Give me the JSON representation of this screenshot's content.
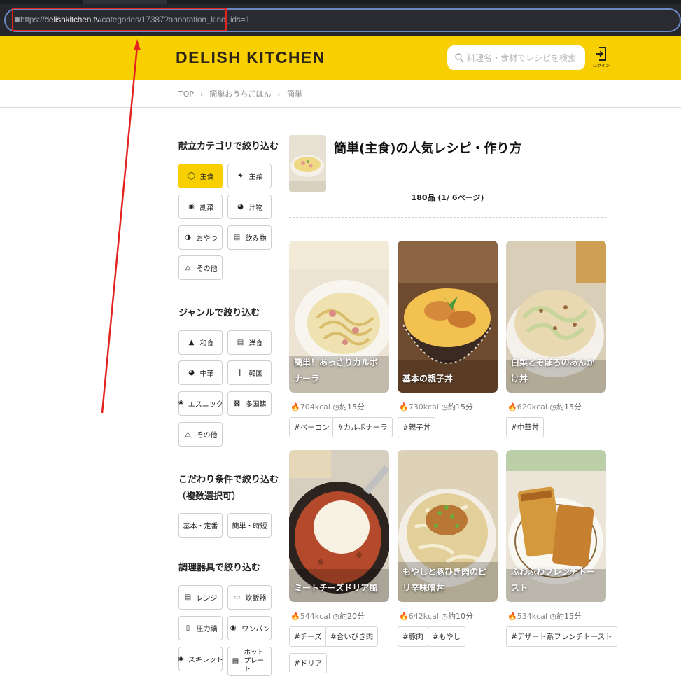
{
  "browser": {
    "url_prefix": "https://",
    "url_domain": "delishkitchen.tv",
    "url_path": "/categories/17387?annotation_kind_ids=1"
  },
  "header": {
    "logo": "DELISH KITCHEN",
    "search_placeholder": "料理名・食材でレシピを検索",
    "login_label": "ログイン"
  },
  "breadcrumb": [
    "TOP",
    "簡単おうちごはん",
    "簡単"
  ],
  "sidebar": {
    "menu_title": "献立カテゴリで絞り込む",
    "menu": [
      {
        "label": "主食",
        "icon": "rice-bowl-icon",
        "selected": true
      },
      {
        "label": "主菜",
        "icon": "main-dish-icon",
        "selected": false
      },
      {
        "label": "副菜",
        "icon": "side-dish-icon",
        "selected": false
      },
      {
        "label": "汁物",
        "icon": "soup-icon",
        "selected": false
      },
      {
        "label": "おやつ",
        "icon": "snack-icon",
        "selected": false
      },
      {
        "label": "飲み物",
        "icon": "drink-icon",
        "selected": false
      },
      {
        "label": "その他",
        "icon": "other-icon",
        "selected": false
      }
    ],
    "genre_title": "ジャンルで絞り込む",
    "genre": [
      {
        "label": "和食",
        "icon": "onigiri-icon"
      },
      {
        "label": "洋食",
        "icon": "burger-icon"
      },
      {
        "label": "中華",
        "icon": "dumpling-icon"
      },
      {
        "label": "韓国",
        "icon": "chili-icon"
      },
      {
        "label": "エスニック",
        "icon": "ethnic-icon"
      },
      {
        "label": "多国籍",
        "icon": "multinational-icon"
      },
      {
        "label": "その他",
        "icon": "other-icon"
      }
    ],
    "kodawari_title_1": "こだわり条件で絞り込む",
    "kodawari_title_2": "（複数選択可）",
    "kodawari": [
      {
        "label": "基本・定番"
      },
      {
        "label": "簡単・時短"
      }
    ],
    "tools_title": "調理器具で絞り込む",
    "tools": [
      {
        "label": "レンジ",
        "icon": "microwave-icon"
      },
      {
        "label": "炊飯器",
        "icon": "rice-cooker-icon"
      },
      {
        "label": "圧力鍋",
        "icon": "pressure-cooker-icon"
      },
      {
        "label": "ワンパン",
        "icon": "pan-icon"
      },
      {
        "label": "スキレット",
        "icon": "skillet-icon"
      },
      {
        "label": "ホットプレート",
        "icon": "hot-plate-icon"
      }
    ]
  },
  "main": {
    "title": "簡単(主食)の人気レシピ・作り方",
    "count": "180品 (1/ 6ページ)",
    "recipes": [
      {
        "title": "簡単！あっさりカルボナーラ",
        "kcal": "704kcal",
        "time": "約15分",
        "tags": [
          "#ベーコン",
          "#カルボナーラ"
        ],
        "palette": [
          "#e9dfcf",
          "#f2e7c2",
          "#d8b96e"
        ]
      },
      {
        "title": "基本の親子丼",
        "kcal": "730kcal",
        "time": "約15分",
        "tags": [
          "#親子丼"
        ],
        "palette": [
          "#5b3a25",
          "#e9a94a",
          "#f4d56c"
        ]
      },
      {
        "title": "白菜とそぼろのあんかけ丼",
        "kcal": "620kcal",
        "time": "約15分",
        "tags": [
          "#中華丼"
        ],
        "palette": [
          "#d9c8a4",
          "#e8e1c7",
          "#a9804d"
        ]
      },
      {
        "title": "ミートチーズドリア風",
        "kcal": "544kcal",
        "time": "約20分",
        "tags": [
          "#チーズ",
          "#合いびき肉",
          "#ドリア"
        ],
        "palette": [
          "#4a3328",
          "#c5532f",
          "#f3ecd9"
        ]
      },
      {
        "title": "もやしと豚ひき肉のピリ辛味噌丼",
        "kcal": "642kcal",
        "time": "約10分",
        "tags": [
          "#豚肉",
          "#もやし"
        ],
        "palette": [
          "#d9cdb0",
          "#c98a45",
          "#6aa33c"
        ]
      },
      {
        "title": "ふわふわフレンチトースト",
        "kcal": "534kcal",
        "time": "約15分",
        "tags": [
          "#デザート系フレンチトースト"
        ],
        "palette": [
          "#e8e2d4",
          "#d69a3e",
          "#a76523"
        ]
      }
    ]
  },
  "colors": {
    "brand_yellow": "#f8d001",
    "annotation_red": "#e3231f"
  }
}
